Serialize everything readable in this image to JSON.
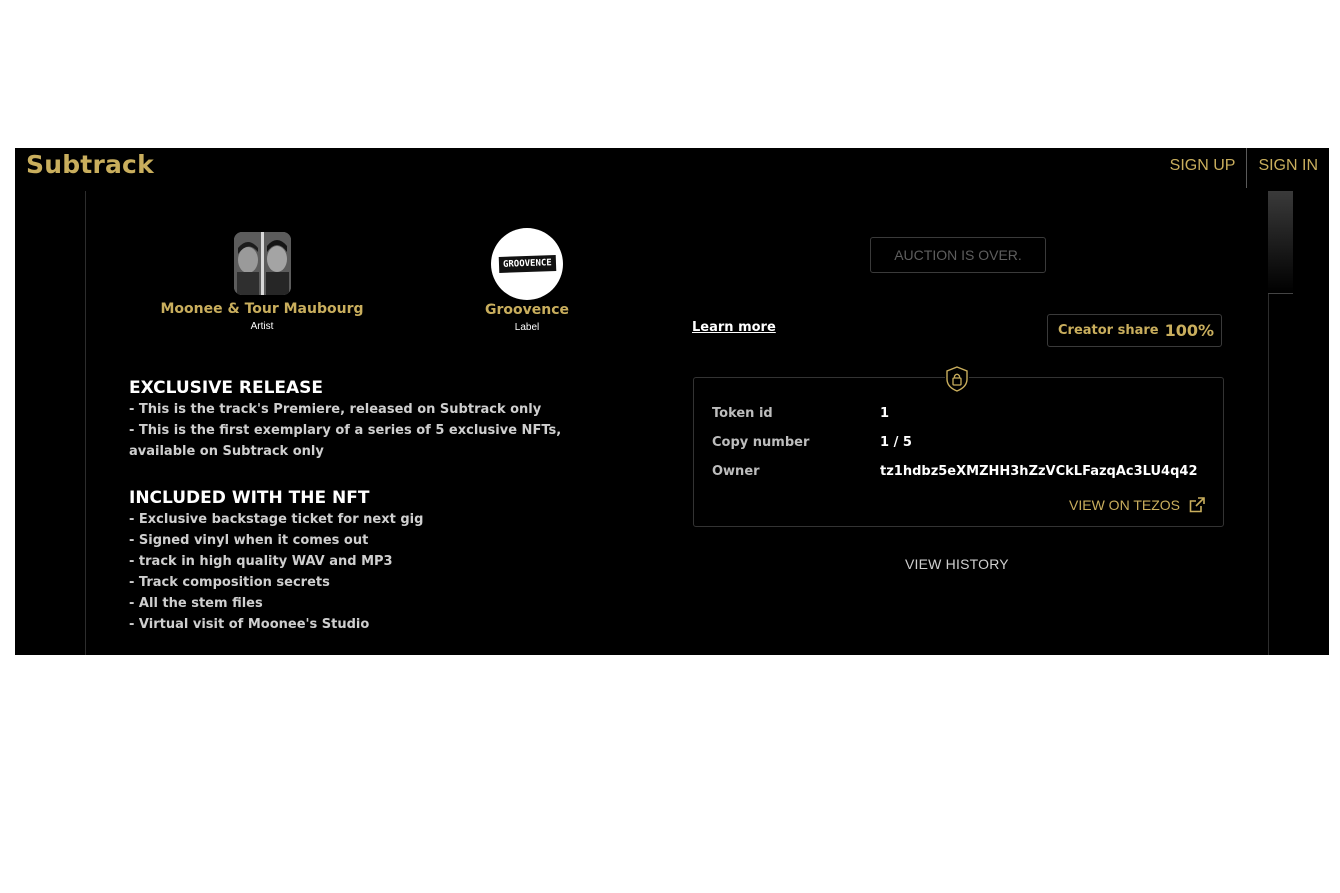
{
  "header": {
    "brand": "Subtrack",
    "sign_up": "SIGN UP",
    "sign_in": "SIGN IN"
  },
  "artist": {
    "name": "Moonee & Tour Maubourg",
    "role": "Artist"
  },
  "label": {
    "name": "Groovence",
    "role": "Label",
    "logo_text": "GROOVENCE"
  },
  "description": {
    "exclusive_title": "EXCLUSIVE RELEASE",
    "exclusive_lines": [
      "- This is the track's Premiere, released on Subtrack only",
      "- This is the first exemplary of a series of 5 exclusive NFTs,",
      "available on Subtrack only"
    ],
    "included_title": "INCLUDED WITH THE NFT",
    "included_lines": [
      "- Exclusive backstage ticket for next gig",
      "- Signed vinyl when it comes out",
      "- track in high quality WAV and MP3",
      "- Track composition secrets",
      "- All the stem files",
      "- Virtual visit of Moonee's Studio"
    ]
  },
  "auction": {
    "status": "AUCTION IS OVER."
  },
  "learn_more": "Learn more",
  "creator_share": {
    "label": "Creator share",
    "value": "100%"
  },
  "token": {
    "token_id_label": "Token id",
    "token_id": "1",
    "copy_label": "Copy number",
    "copy_value": "1 / 5",
    "owner_label": "Owner",
    "owner_value": "tz1hdbz5eXMZHH3hZzVCkLFazqAc3LU4q42",
    "view_on_tezos": "VIEW ON TEZOS"
  },
  "view_history": "VIEW HISTORY",
  "colors": {
    "accent": "#c9ae5d",
    "background": "#000000"
  }
}
